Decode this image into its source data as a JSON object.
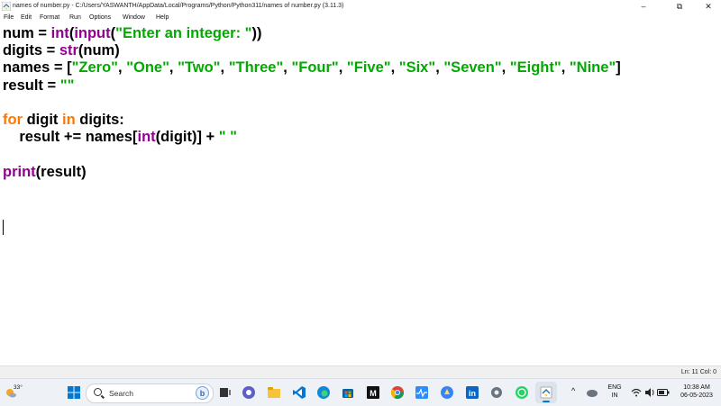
{
  "window": {
    "title": "names of number.py - C:/Users/YASWANTH/AppData/Local/Programs/Python/Python311/names of number.py (3.11.3)",
    "minimize": "–",
    "maximize": "⧉",
    "close": "✕"
  },
  "menu": [
    "File",
    "Edit",
    "Format",
    "Run",
    "Options",
    "Window",
    "Help"
  ],
  "code": {
    "l1": {
      "a": "num = ",
      "b": "int",
      "c": "(",
      "d": "input",
      "e": "(",
      "f": "\"Enter an integer: \"",
      "g": "))"
    },
    "l2": {
      "a": "digits = ",
      "b": "str",
      "c": "(num)"
    },
    "l3": {
      "a": "names = [",
      "s": [
        "\"Zero\"",
        "\"One\"",
        "\"Two\"",
        "\"Three\"",
        "\"Four\"",
        "\"Five\"",
        "\"Six\"",
        "\"Seven\"",
        "\"Eight\"",
        "\"Nine\""
      ],
      "sep": ", ",
      "end": "]"
    },
    "l4": {
      "a": "result = ",
      "s": "\"\""
    },
    "l6": {
      "kw1": "for",
      "a": " digit ",
      "kw2": "in",
      "b": " digits:"
    },
    "l7": {
      "a": "    result += names[",
      "b": "int",
      "c": "(digit)] + ",
      "s": "\" \""
    },
    "l9": {
      "b": "print",
      "a": "(result)"
    }
  },
  "status": {
    "position": "Ln: 11   Col: 0"
  },
  "taskbar": {
    "weather_temp": "33°",
    "search_placeholder": "Search",
    "lang_top": "ENG",
    "lang_bottom": "IN",
    "time": "10:38 AM",
    "date": "06-05-2023",
    "chevron": "^"
  },
  "colors": {
    "keyword": "#ff7700",
    "builtin": "#900090",
    "string": "#00aa00"
  }
}
